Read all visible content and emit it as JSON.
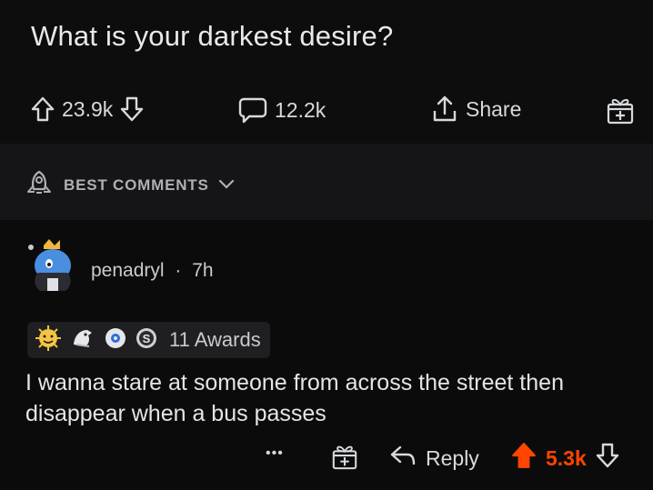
{
  "post": {
    "title": "What is your darkest desire?",
    "upvotes": "23.9k",
    "comments": "12.2k",
    "share_label": "Share"
  },
  "sort": {
    "label": "BEST COMMENTS"
  },
  "comment": {
    "username": "penadryl",
    "separator": "·",
    "age": "7h",
    "awards_label": "11 Awards",
    "text": "I wanna stare at someone from across the street then disappear when a bus passes",
    "more": "•••",
    "reply_label": "Reply",
    "score": "5.3k"
  },
  "colors": {
    "background": "#0b0b0c",
    "upvote_active": "#ff4500",
    "text": "#d7dadc"
  },
  "icons": {
    "upvote": "arrow-up-icon",
    "downvote": "arrow-down-icon",
    "comment": "speech-bubble-icon",
    "share": "share-icon",
    "award": "gift-icon",
    "sort": "rocket-icon",
    "chevron": "chevron-down-icon",
    "reply": "reply-arrow-icon"
  }
}
